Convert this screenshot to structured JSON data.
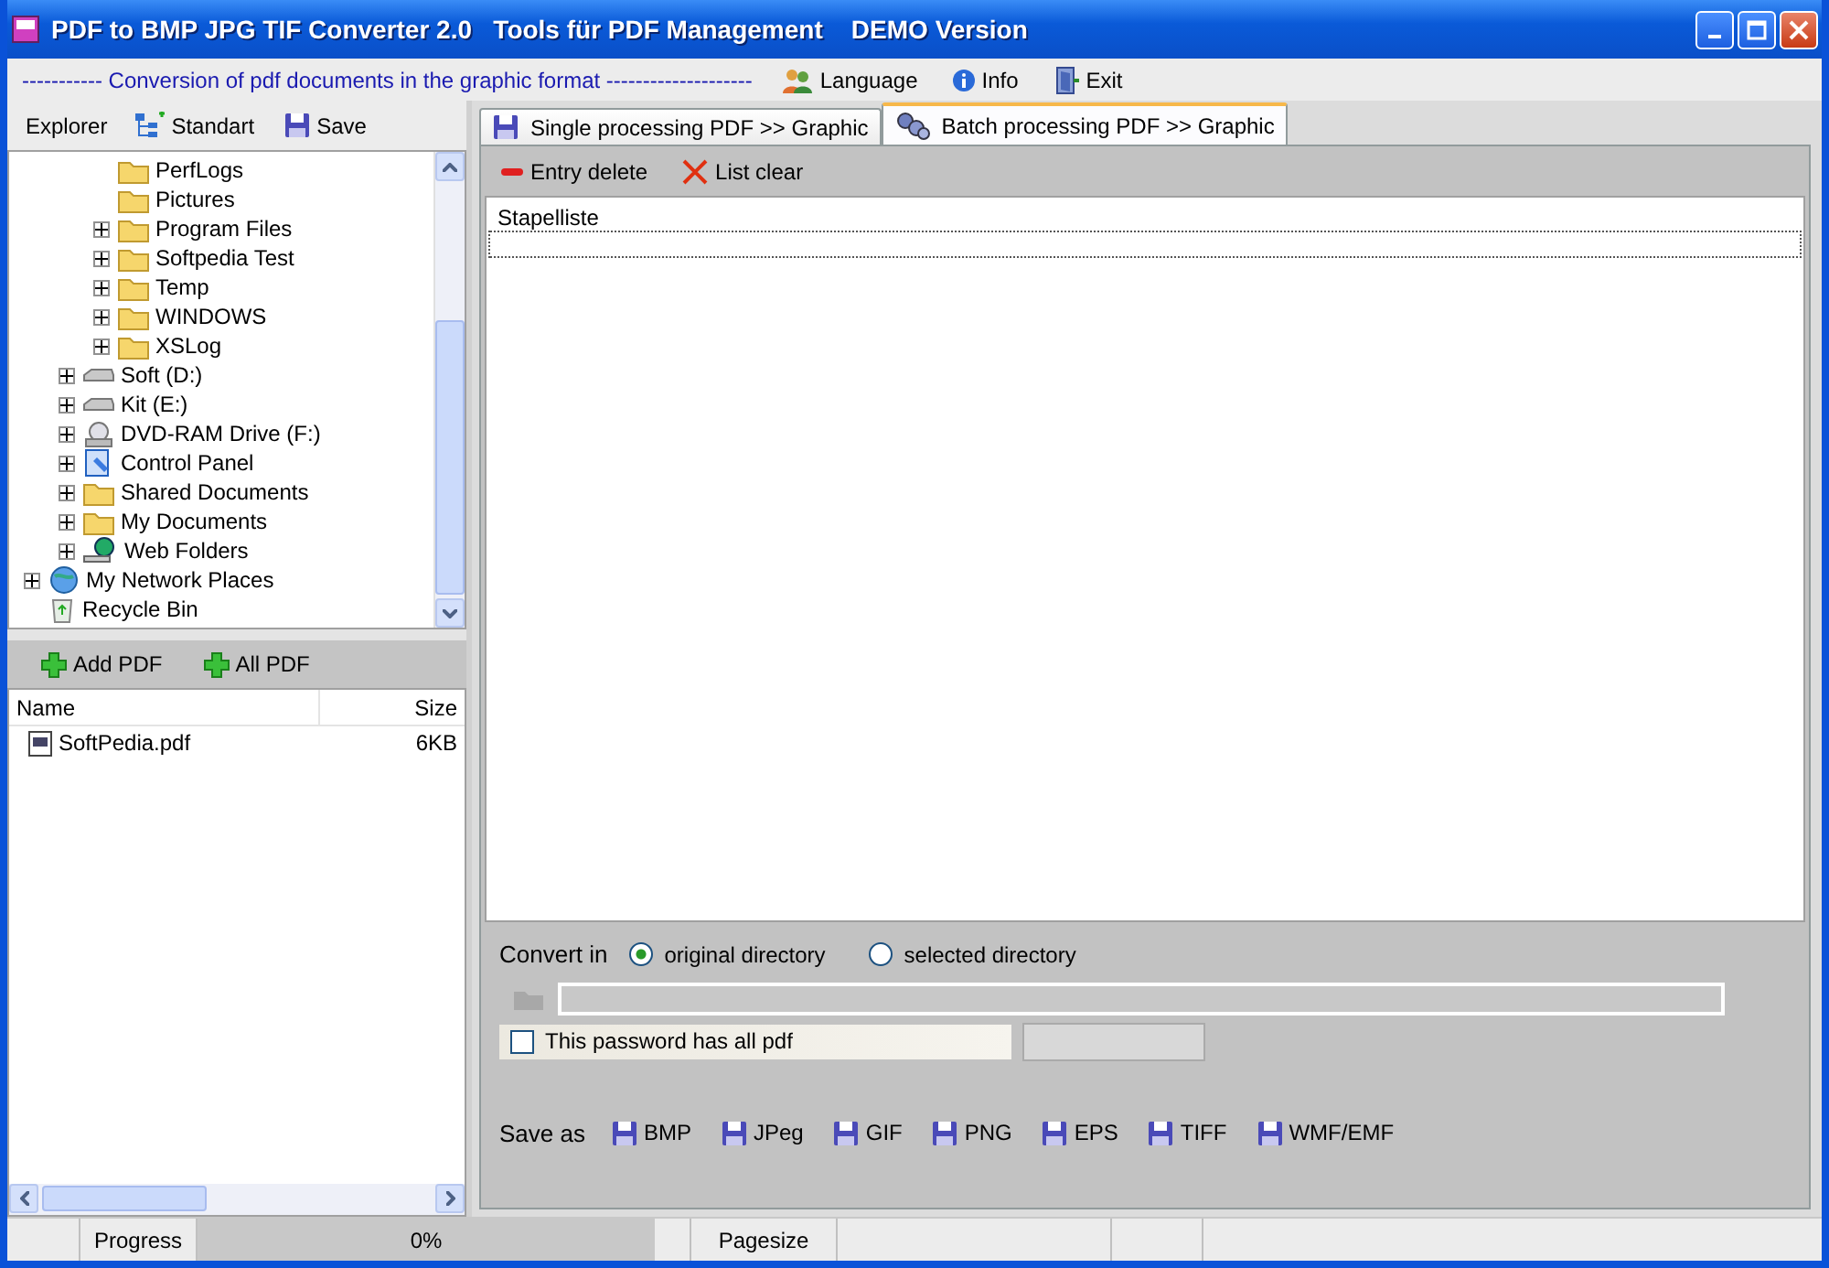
{
  "window": {
    "title": "PDF to BMP JPG TIF Converter 2.0   Tools für PDF Management    DEMO Version"
  },
  "toolbar": {
    "caption": "----------- Conversion of pdf documents in the graphic format --------------------",
    "buttons": [
      {
        "label": "Language",
        "kind": "people"
      },
      {
        "label": "Info",
        "kind": "info"
      },
      {
        "label": "Exit",
        "kind": "exit"
      }
    ]
  },
  "explorer": {
    "title": "Explorer",
    "buttons": [
      {
        "label": "Standart",
        "kind": "tree"
      },
      {
        "label": "Save",
        "kind": "floppy"
      }
    ],
    "tree": [
      {
        "children": [
          {
            "children": [
              {
                "label": "PerfLogs",
                "kind": "folder",
                "expandable": false
              },
              {
                "label": "Pictures",
                "kind": "folder",
                "expandable": false
              },
              {
                "label": "Program Files",
                "kind": "folder",
                "expandable": true
              },
              {
                "label": "Softpedia Test",
                "kind": "folder",
                "expandable": true
              },
              {
                "label": "Temp",
                "kind": "folder",
                "expandable": true
              },
              {
                "label": "WINDOWS",
                "kind": "folder",
                "expandable": true
              },
              {
                "label": "XSLog",
                "kind": "folder",
                "expandable": true
              }
            ]
          },
          {
            "label": "Soft (D:)",
            "kind": "drive",
            "expandable": true
          },
          {
            "label": "Kit (E:)",
            "kind": "drive",
            "expandable": true
          },
          {
            "label": "DVD-RAM Drive (F:)",
            "kind": "dvd",
            "expandable": true
          },
          {
            "label": "Control Panel",
            "kind": "panel",
            "expandable": true
          },
          {
            "label": "Shared Documents",
            "kind": "folder",
            "expandable": true
          },
          {
            "label": "My Documents",
            "kind": "folder",
            "expandable": true
          },
          {
            "label": "Web Folders",
            "kind": "web",
            "expandable": true
          }
        ]
      },
      {
        "label": "My Network Places",
        "kind": "network",
        "expandable": true
      },
      {
        "label": "Recycle Bin",
        "kind": "recycle",
        "expandable": false
      }
    ]
  },
  "files": {
    "buttons": [
      {
        "label": "Add PDF"
      },
      {
        "label": "All PDF"
      }
    ],
    "columns": [
      "Name",
      "Size"
    ],
    "rows": [
      {
        "name": "SoftPedia.pdf",
        "size": "6KB"
      }
    ]
  },
  "tabs": [
    {
      "label": "Single processing PDF >> Graphic",
      "kind": "floppy",
      "selected": false
    },
    {
      "label": "Batch processing PDF >> Graphic",
      "kind": "gears",
      "selected": true
    }
  ],
  "batch": {
    "buttons": [
      {
        "label": "Entry delete",
        "kind": "minus"
      },
      {
        "label": "List clear",
        "kind": "cross"
      }
    ],
    "list_header": "Stapelliste"
  },
  "convert": {
    "label": "Convert in",
    "options": [
      {
        "label": "original directory",
        "selected": true
      },
      {
        "label": "selected directory",
        "selected": false
      }
    ],
    "password": {
      "label": "This password has all pdf",
      "checked": false
    },
    "save_as": {
      "label": "Save as",
      "formats": [
        "BMP",
        "JPeg",
        "GIF",
        "PNG",
        "EPS",
        "TIFF",
        "WMF/EMF"
      ]
    }
  },
  "status_bar": {
    "progress_label": "Progress",
    "progress": {
      "level": 0,
      "reading": "0%"
    },
    "pagesize_label": "Pagesize"
  }
}
